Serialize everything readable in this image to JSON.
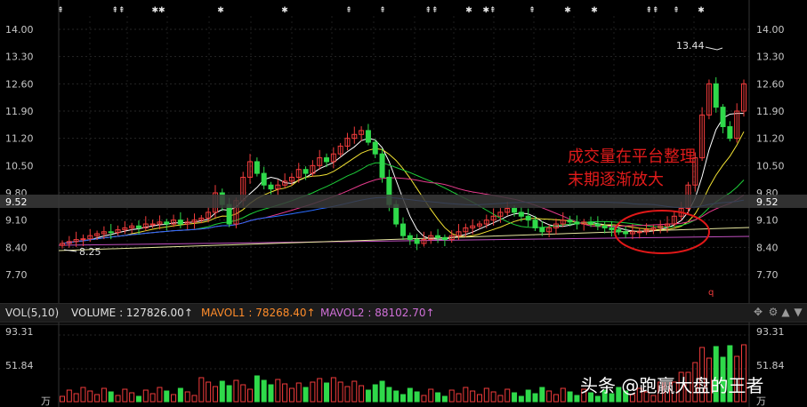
{
  "colors": {
    "up": "#f23c3c",
    "down": "#2fd94a",
    "bg": "#000000",
    "ma5": "#ffffff",
    "ma10": "#f2e233",
    "ma20": "#1ecf3a",
    "ma30": "#e23a8a",
    "ma60": "#2a6cff",
    "vol": "#ff8c2a",
    "mavol2": "#d070d8"
  },
  "price_axis": {
    "ticks": [
      "14.00",
      "13.30",
      "12.60",
      "11.90",
      "11.20",
      "10.50",
      "9.80",
      "9.10",
      "8.40",
      "7.70"
    ],
    "current": "9.52"
  },
  "annotations": {
    "high": "13.44",
    "low": "8.25",
    "note_line1": "成交量在平台整理",
    "note_line2": "末期逐渐放大"
  },
  "vol_panel": {
    "indicator": "VOL(5,10)",
    "volume": "VOLUME : 127826.00↑",
    "mavol1": "MAVOL1 : 78268.40↑",
    "mavol2": "MAVOL2 : 88102.70↑",
    "ticks": [
      "93.31",
      "51.84"
    ],
    "unit": "万"
  },
  "tools": {
    "move": "move-icon",
    "settings": "gear-icon",
    "up": "arrow-up-icon",
    "down": "arrow-down-icon"
  },
  "watermark": "头条 @跑赢大盘的王者"
}
